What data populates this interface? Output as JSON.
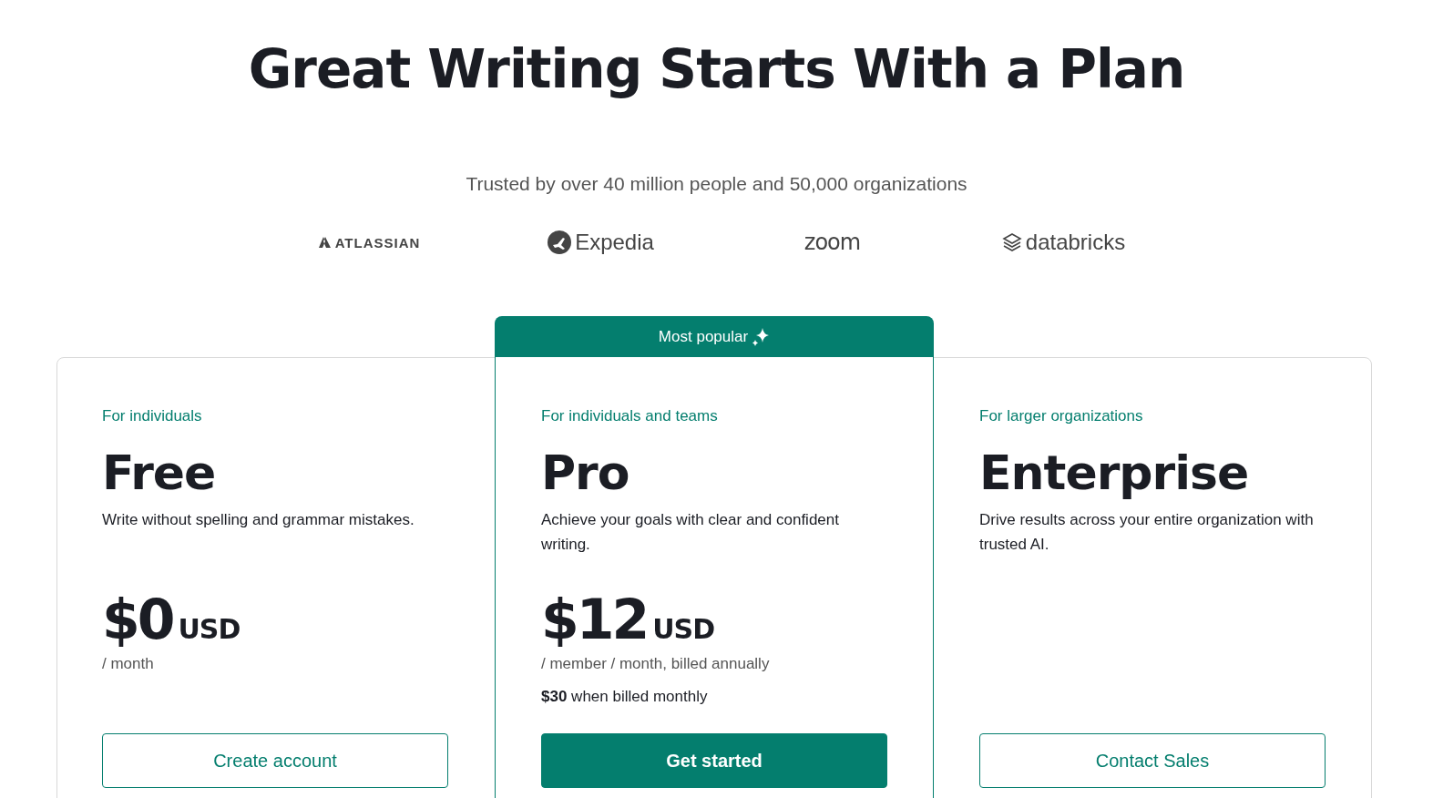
{
  "title": "Great Writing Starts With a Plan",
  "trusted": "Trusted by over 40 million people and 50,000 organizations",
  "logos": [
    {
      "kind": "atlassian",
      "name": "ATLASSIAN"
    },
    {
      "kind": "expedia",
      "name": "Expedia"
    },
    {
      "kind": "zoom",
      "name": "zoom"
    },
    {
      "kind": "databricks",
      "name": "databricks"
    }
  ],
  "plans": [
    {
      "audience": "For individuals",
      "name": "Free",
      "featured": false,
      "description": "Write without spelling and grammar mistakes.",
      "price": "$0",
      "currency": "USD",
      "period": "/ month",
      "button": "Create account"
    },
    {
      "audience": "For individuals and teams",
      "name": "Pro",
      "featured": true,
      "badge": "Most popular",
      "description": "Achieve your goals with clear and confident writing.",
      "price": "$12",
      "currency": "USD",
      "period": "/ member / month, billed annually",
      "note": "**$30** when billed monthly",
      "button": "Get started"
    },
    {
      "audience": "For larger organizations",
      "name": "Enterprise",
      "featured": false,
      "description": "Drive results across your entire organization with trusted AI.",
      "button": "Contact Sales"
    }
  ]
}
